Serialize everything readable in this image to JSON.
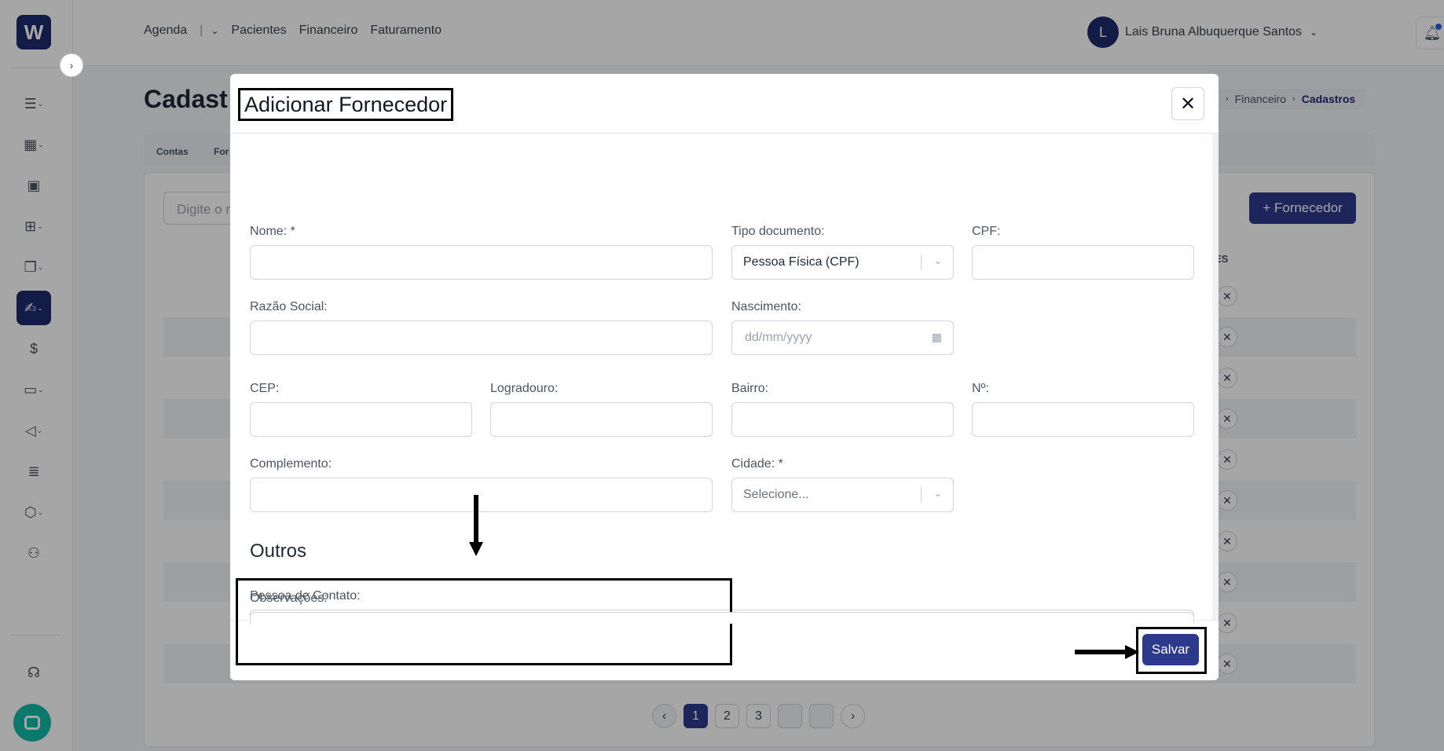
{
  "nav": {
    "agenda": "Agenda",
    "pacientes": "Pacientes",
    "financeiro": "Financeiro",
    "faturamento": "Faturamento"
  },
  "user": {
    "initial": "L",
    "name": "Lais Bruna Albuquerque Santos"
  },
  "page": {
    "title": "Cadast",
    "breadcrumb": {
      "financeiro": "Financeiro",
      "cadastros": "Cadastros"
    },
    "tabs": {
      "contas": "Contas",
      "fornecedores": "For"
    },
    "search_placeholder": "Digite o n",
    "add_button": "+ Fornecedor",
    "column_head": "ES",
    "pagination": [
      "1",
      "2",
      "3"
    ]
  },
  "modal": {
    "title": "Adicionar Fornecedor",
    "labels": {
      "nome": "Nome: *",
      "tipo_documento": "Tipo documento:",
      "cpf": "CPF:",
      "razao_social": "Razão Social:",
      "nascimento": "Nascimento:",
      "cep": "CEP:",
      "logradouro": "Logradouro:",
      "bairro": "Bairro:",
      "numero": "Nº:",
      "complemento": "Complemento:",
      "cidade": "Cidade: *",
      "pessoa_contato": "Pessoa de Contato:",
      "observacoes": "Observações:"
    },
    "values": {
      "tipo_documento": "Pessoa Física (CPF)",
      "nascimento_placeholder": "dd/mm/yyyy",
      "cidade_placeholder": "Selecione..."
    },
    "section_outros": "Outros",
    "save_button": "Salvar"
  },
  "colors": {
    "brand": "#1e2a6e",
    "primary_button": "#2d3a8c",
    "chat": "#14b8a6"
  },
  "icons": [
    "menu-list-icon",
    "calendar-icon",
    "id-card-icon",
    "briefcase-icon",
    "documents-icon",
    "handshake-icon",
    "dollar-icon",
    "monitor-icon",
    "megaphone-icon",
    "news-icon",
    "box-icon",
    "users-icon",
    "headset-icon",
    "chat-icon",
    "bell-icon"
  ]
}
